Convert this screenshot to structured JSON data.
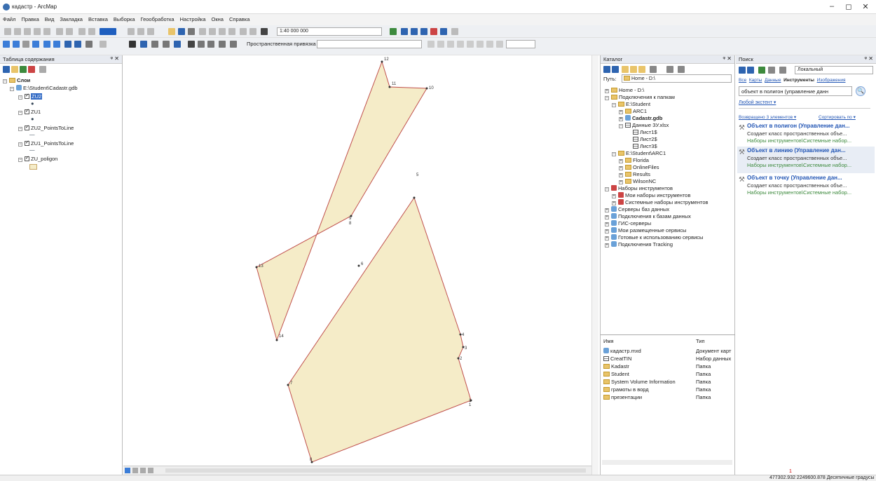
{
  "window": {
    "title": "кадастр - ArcMap",
    "minimize": "–",
    "maximize": "◻",
    "close": "✕"
  },
  "menu": [
    "Файл",
    "Правка",
    "Вид",
    "Закладка",
    "Вставка",
    "Выборка",
    "Геообработка",
    "Настройка",
    "Окна",
    "Справка"
  ],
  "toolbar": {
    "scale": "1:40 000 000",
    "spatial_adjust": "Пространственная привязка ▾"
  },
  "toc": {
    "title": "Таблица содержания",
    "layers_root": "Слои",
    "gdb_path": "E:\\Student\\Cadastr.gdb",
    "layers": [
      {
        "name": "ZU2",
        "selected": true
      },
      {
        "name": "ZU1",
        "selected": false
      },
      {
        "name": "ZU2_PointsToLine",
        "selected": false
      },
      {
        "name": "ZU1_PointsToLine",
        "selected": false
      },
      {
        "name": "ZU_poligon",
        "selected": false
      }
    ]
  },
  "map": {
    "fill_color": "#f5ecc8",
    "line_color": "#c0504d",
    "upper_labels": [
      "12",
      "11",
      "10",
      "13",
      "14",
      "9",
      "8"
    ],
    "lower_labels": [
      "5",
      "6",
      "4",
      "3",
      "2",
      "1",
      "1",
      "7",
      "8"
    ]
  },
  "catalog": {
    "title": "Каталог",
    "path_label": "Путь:",
    "path_value": "Home - D:\\",
    "tree": [
      "Home - D:\\",
      "Подключения к папкам",
      "E:\\Student",
      "ARC1",
      "Cadastr.gdb",
      "Данные ЗУ.xlsx",
      "Лист1$",
      "Лист2$",
      "Лист3$",
      "E:\\Student\\ARC1",
      "Florida",
      "OnlineFiles",
      "Results",
      "WilsonNC",
      "Наборы инструментов",
      "Мои наборы инструментов",
      "Системные наборы инструментов",
      "Серверы баз данных",
      "Подключения к базам данных",
      "ГИС-серверы",
      "Мои размещенные сервисы",
      "Готовые к использованию сервисы",
      "Подключения Tracking"
    ],
    "list_headers": [
      "Имя",
      "Тип"
    ],
    "list_rows": [
      [
        "кадастр.mxd",
        "Документ карт"
      ],
      [
        "CreatTIN",
        "Набор данных"
      ],
      [
        "Kadastr",
        "Папка"
      ],
      [
        "Student",
        "Папка"
      ],
      [
        "System Volume Information",
        "Папка"
      ],
      [
        "грамоты в ворд",
        "Папка"
      ],
      [
        "презентации",
        "Папка"
      ]
    ]
  },
  "search": {
    "title": "Поиск",
    "scope": "Локальный",
    "tabs": [
      "Все",
      "Карты",
      "Данные",
      "Инструменты",
      "Изображения"
    ],
    "query": "объект в полигон (управление данн",
    "extent": "Любой экстент ▾",
    "returned": "Возвращено 3 элементов ▾",
    "sort": "Сортировать по ▾",
    "results": [
      {
        "title": "Объект в полигон (Управление дан...",
        "line1": "Создает класс пространственных объе...",
        "line2": "Наборы инструментов\\Системные набор..."
      },
      {
        "title": "Объект в линию (Управление дан...",
        "line1": "Создает класс пространственных объе...",
        "line2": "Наборы инструментов\\Системные набор..."
      },
      {
        "title": "Объект в точку (Управление дан...",
        "line1": "Создает класс пространственных объе...",
        "line2": "Наборы инструментов\\Системные набор..."
      }
    ]
  },
  "status": {
    "coords": "477302.932  2249600.878 Десятичные градусы",
    "marker": "1"
  }
}
